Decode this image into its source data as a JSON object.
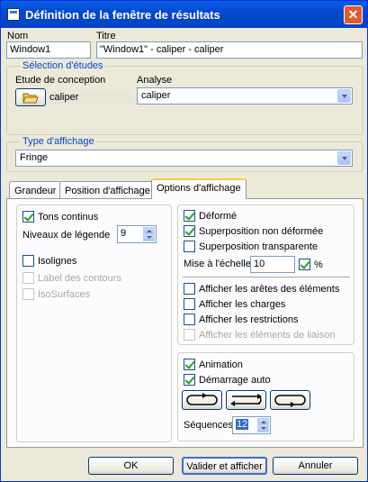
{
  "window": {
    "title": "Définition de la fenêtre de résultats",
    "close_icon": "close-icon"
  },
  "nom": {
    "label": "Nom",
    "value": "Window1"
  },
  "titre": {
    "label": "Titre",
    "value": "\"Window1\" - caliper - caliper"
  },
  "etudes": {
    "group_title": "Sélection d'études",
    "conception_label": "Etude de conception",
    "conception_value": "caliper",
    "analyse_label": "Analyse",
    "analyse_value": "caliper"
  },
  "affichage": {
    "group_title": "Type d'affichage",
    "value": "Fringe"
  },
  "tabs": [
    {
      "label": "Grandeur"
    },
    {
      "label": "Position d'affichage"
    },
    {
      "label": "Options d'affichage"
    }
  ],
  "left": {
    "tons_continus": "Tons continus",
    "niveaux_label": "Niveaux de légende",
    "niveaux_value": "9",
    "isolignes": "Isolignes",
    "label_contours": "Label des contours",
    "isosurfaces": "IsoSurfaces"
  },
  "right": {
    "deforme": "Déformé",
    "superposition_non": "Superposition non déformée",
    "superposition_transp": "Superposition transparente",
    "mise_label": "Mise à l'échelle",
    "mise_value": "10",
    "percent": "%",
    "aretes": "Afficher les arêtes des éléments",
    "charges": "Afficher les charges",
    "restrictions": "Afficher les restrictions",
    "liaison": "Afficher les éléments de liaison"
  },
  "anim": {
    "animation": "Animation",
    "demarrage": "Démarrage auto",
    "sequences_label": "Séquences",
    "sequences_value": "12"
  },
  "buttons": {
    "ok": "OK",
    "valider": "Valider et afficher",
    "annuler": "Annuler"
  }
}
